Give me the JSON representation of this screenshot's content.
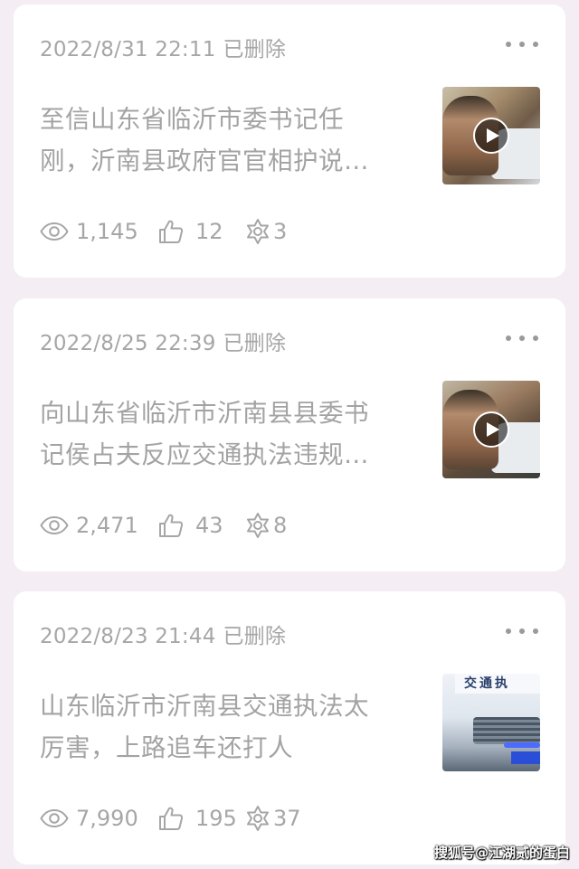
{
  "posts": [
    {
      "date": "2022/8/31 22:11",
      "status": "已删除",
      "title": "至信山东省临沂市委书记任刚，沂南县政府官官相护说…",
      "views": "1,145",
      "likes": "12",
      "shares": "3",
      "thumbnail": "video-thumbnail-man-by-car",
      "has_video": true
    },
    {
      "date": "2022/8/25 22:39",
      "status": "已删除",
      "title": "向山东省临沂市沂南县县委书记侯占夫反应交通执法违规…",
      "views": "2,471",
      "likes": "43",
      "shares": "8",
      "thumbnail": "video-thumbnail-man-closeup",
      "has_video": true
    },
    {
      "date": "2022/8/23 21:44",
      "status": "已删除",
      "title": "山东临沂市沂南县交通执法太厉害，上路追车还打人",
      "views": "7,990",
      "likes": "195",
      "shares": "37",
      "thumbnail": "thumbnail-traffic-enforcement-van",
      "thumbnail_text": "交通执",
      "has_video": false
    }
  ],
  "icons": {
    "more": "more-dots-icon",
    "views": "eye-icon",
    "likes": "thumbs-up-icon",
    "shares": "share-flower-icon",
    "play": "play-icon"
  },
  "watermark": "搜狐号@江湖贰的蛋白"
}
